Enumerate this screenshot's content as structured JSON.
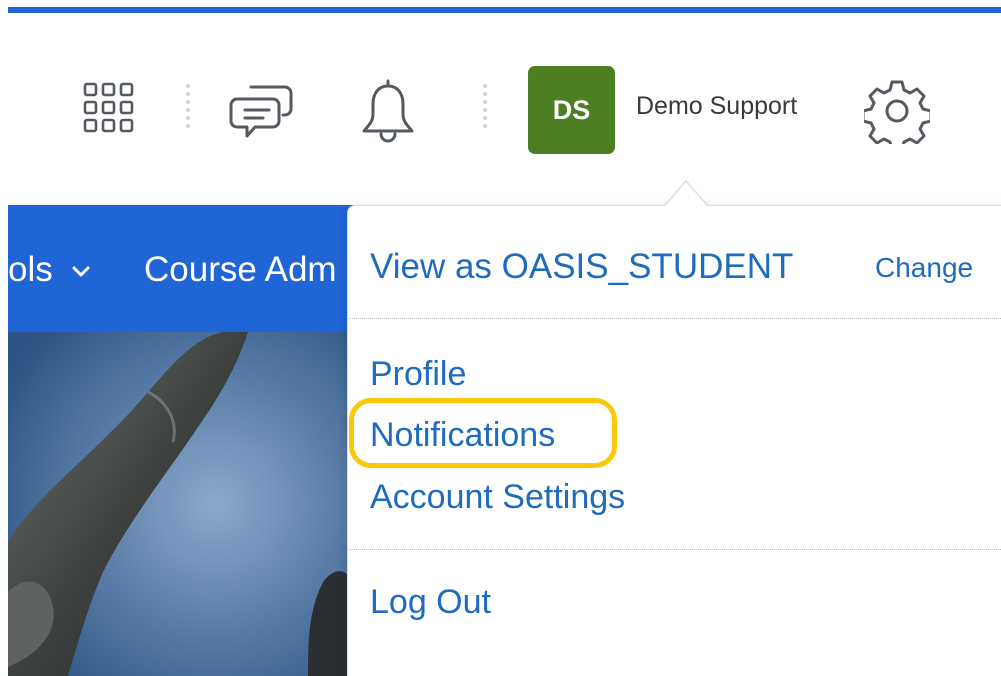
{
  "header": {
    "icons": {
      "apps": "waffle-grid-icon",
      "messages": "chat-bubbles-icon",
      "notifications": "bell-icon",
      "settings": "gear-icon"
    },
    "user": {
      "initials": "DS",
      "name": "Demo Support",
      "avatar_color": "#4b7f21"
    }
  },
  "navbar": {
    "items": [
      {
        "label": "ols"
      },
      {
        "label": "Course Adm"
      }
    ],
    "color": "#1f65d6"
  },
  "user_menu": {
    "role": {
      "view_as": "View as OASIS_STUDENT",
      "change": "Change"
    },
    "links": [
      {
        "label": "Profile"
      },
      {
        "label": "Notifications",
        "highlighted": true
      },
      {
        "label": "Account Settings"
      }
    ],
    "logout": "Log Out",
    "link_color": "#1e6bbf",
    "highlight_color": "#f7c90a"
  }
}
